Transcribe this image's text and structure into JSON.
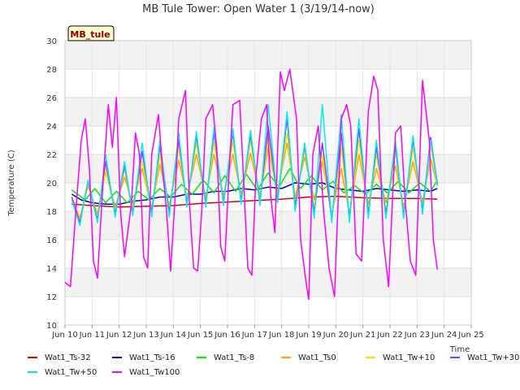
{
  "chart_data": {
    "type": "line",
    "title": "MB Tule Tower: Open Water 1 (3/19/14-now)",
    "xlabel": "Time",
    "ylabel": "Temperature (C)",
    "xlim": [
      10,
      25
    ],
    "ylim": [
      10,
      30
    ],
    "x_ticks": [
      10,
      11,
      12,
      13,
      14,
      15,
      16,
      17,
      18,
      19,
      20,
      21,
      22,
      23,
      24,
      25
    ],
    "x_tick_labels": [
      "Jun 10",
      "Jun 11",
      "Jun 12",
      "Jun 13",
      "Jun 14",
      "Jun 15",
      "Jun 16",
      "Jun 17",
      "Jun 18",
      "Jun 19",
      "Jun 20",
      "Jun 21",
      "Jun 22",
      "Jun 23",
      "Jun 24",
      "Jun 25"
    ],
    "y_ticks": [
      10,
      12,
      14,
      16,
      18,
      20,
      22,
      24,
      26,
      28,
      30
    ],
    "y_tick_labels": [
      "10",
      "12",
      "14",
      "16",
      "18",
      "20",
      "22",
      "24",
      "26",
      "28",
      "30"
    ],
    "station_label": "MB_tule",
    "legend_position": "bottom",
    "grid": true,
    "series": [
      {
        "name": "Wat1_Ts-32",
        "color": "#dd0000",
        "x": [
          10.25,
          11.0,
          12.0,
          13.0,
          14.0,
          15.0,
          16.0,
          17.0,
          18.0,
          19.0,
          20.0,
          21.0,
          22.0,
          23.0,
          23.75
        ],
        "y": [
          18.5,
          18.4,
          18.3,
          18.35,
          18.4,
          18.55,
          18.65,
          18.75,
          18.85,
          19.0,
          19.05,
          18.95,
          18.9,
          18.9,
          18.85
        ]
      },
      {
        "name": "Wat1_Ts-16",
        "color": "#0000cc",
        "x": [
          10.25,
          10.6,
          11.0,
          11.5,
          12.0,
          12.5,
          13.0,
          13.5,
          14.0,
          14.5,
          15.0,
          15.5,
          16.0,
          16.5,
          17.0,
          17.5,
          18.0,
          18.5,
          19.0,
          19.5,
          20.0,
          20.5,
          21.0,
          21.5,
          22.0,
          22.5,
          23.0,
          23.5,
          23.75
        ],
        "y": [
          19.2,
          18.8,
          18.6,
          18.5,
          18.5,
          18.7,
          18.8,
          19.0,
          19.0,
          19.2,
          19.2,
          19.4,
          19.4,
          19.6,
          19.5,
          19.7,
          19.6,
          20.0,
          19.9,
          20.0,
          19.6,
          19.5,
          19.4,
          19.6,
          19.5,
          19.4,
          19.5,
          19.4,
          19.6
        ]
      },
      {
        "name": "Wat1_Ts-8",
        "color": "#00ee00",
        "x": [
          10.25,
          10.75,
          11.1,
          11.5,
          11.9,
          12.3,
          12.7,
          13.1,
          13.5,
          13.9,
          14.3,
          14.7,
          15.1,
          15.5,
          15.9,
          16.3,
          16.7,
          17.1,
          17.5,
          17.9,
          18.3,
          18.7,
          19.1,
          19.5,
          19.9,
          20.3,
          20.7,
          21.1,
          21.5,
          21.9,
          22.3,
          22.7,
          23.1,
          23.5,
          23.75
        ],
        "y": [
          19.5,
          18.8,
          19.6,
          18.6,
          19.4,
          18.6,
          19.4,
          18.8,
          19.6,
          19.0,
          19.9,
          19.2,
          20.2,
          19.3,
          20.5,
          19.4,
          20.6,
          19.5,
          20.7,
          19.7,
          21.0,
          19.6,
          20.5,
          19.5,
          20.1,
          19.3,
          19.8,
          19.2,
          19.9,
          19.3,
          20.1,
          19.3,
          20.0,
          19.4,
          20.2
        ]
      },
      {
        "name": "Wat1_Ts0",
        "color": "#ffa500",
        "x": [
          10.25,
          10.55,
          10.85,
          11.2,
          11.5,
          11.85,
          12.2,
          12.5,
          12.85,
          13.2,
          13.5,
          13.85,
          14.2,
          14.5,
          14.85,
          15.2,
          15.5,
          15.85,
          16.2,
          16.5,
          16.85,
          17.2,
          17.5,
          17.85,
          18.2,
          18.5,
          18.85,
          19.2,
          19.5,
          19.85,
          20.2,
          20.5,
          20.85,
          21.2,
          21.5,
          21.85,
          22.2,
          22.5,
          22.85,
          23.2,
          23.5,
          23.75
        ],
        "y": [
          19.0,
          17.5,
          19.8,
          17.8,
          20.8,
          18.3,
          20.4,
          18.5,
          21.0,
          18.2,
          21.3,
          18.4,
          21.6,
          19.0,
          22.0,
          19.0,
          22.0,
          19.1,
          22.0,
          19.2,
          22.1,
          19.1,
          22.5,
          19.3,
          22.8,
          19.0,
          21.8,
          18.8,
          21.5,
          17.8,
          21.0,
          17.8,
          22.0,
          18.5,
          21.0,
          18.6,
          21.2,
          18.3,
          21.5,
          18.6,
          21.7,
          19.8
        ]
      },
      {
        "name": "Wat1_Tw+10",
        "color": "#eeee00",
        "x": [
          10.25,
          10.55,
          10.85,
          11.2,
          11.5,
          11.85,
          12.2,
          12.5,
          12.85,
          13.2,
          13.5,
          13.85,
          14.2,
          14.5,
          14.85,
          15.2,
          15.5,
          15.85,
          16.2,
          16.5,
          16.85,
          17.2,
          17.5,
          17.85,
          18.2,
          18.5,
          18.85,
          19.2,
          19.5,
          19.85,
          20.2,
          20.5,
          20.85,
          21.2,
          21.5,
          21.85,
          22.2,
          22.5,
          22.85,
          23.2,
          23.5,
          23.75
        ],
        "y": [
          19.0,
          17.3,
          20.0,
          17.6,
          21.0,
          18.0,
          21.0,
          18.1,
          21.5,
          18.0,
          22.0,
          18.1,
          22.5,
          18.8,
          22.8,
          18.7,
          22.8,
          18.8,
          22.9,
          18.9,
          23.0,
          18.8,
          23.3,
          19.0,
          23.5,
          18.5,
          22.3,
          18.2,
          22.0,
          17.5,
          22.5,
          17.4,
          23.0,
          18.0,
          22.0,
          18.0,
          22.2,
          17.9,
          22.5,
          18.2,
          22.6,
          19.9
        ]
      },
      {
        "name": "Wat1_Tw+30",
        "color": "#9933ff",
        "x": [
          10.25,
          10.55,
          10.85,
          11.2,
          11.5,
          11.85,
          12.2,
          12.5,
          12.85,
          13.2,
          13.5,
          13.85,
          14.2,
          14.5,
          14.85,
          15.2,
          15.5,
          15.85,
          16.2,
          16.5,
          16.85,
          17.2,
          17.5,
          17.85,
          18.2,
          18.5,
          18.85,
          19.2,
          19.5,
          19.85,
          20.2,
          20.5,
          20.85,
          21.2,
          21.5,
          21.85,
          22.2,
          22.5,
          22.85,
          23.2,
          23.5,
          23.75
        ],
        "y": [
          19.0,
          17.2,
          20.1,
          17.4,
          21.5,
          17.8,
          21.2,
          17.9,
          22.2,
          17.9,
          22.6,
          17.9,
          23.0,
          18.5,
          23.3,
          18.5,
          23.5,
          18.6,
          23.5,
          18.7,
          23.4,
          18.6,
          24.0,
          18.8,
          24.5,
          18.3,
          22.6,
          17.9,
          22.8,
          17.4,
          23.5,
          17.5,
          23.8,
          17.8,
          22.5,
          17.8,
          22.6,
          17.7,
          23.0,
          18.0,
          23.2,
          19.9
        ]
      },
      {
        "name": "Wat1_Tw+50",
        "color": "#00eeee",
        "x": [
          10.25,
          10.55,
          10.85,
          11.2,
          11.5,
          11.85,
          12.2,
          12.5,
          12.85,
          13.2,
          13.5,
          13.85,
          14.2,
          14.5,
          14.85,
          15.2,
          15.5,
          15.85,
          16.2,
          16.5,
          16.85,
          17.2,
          17.5,
          17.85,
          18.2,
          18.5,
          18.85,
          19.2,
          19.5,
          19.85,
          20.2,
          20.5,
          20.85,
          21.2,
          21.5,
          21.85,
          22.2,
          22.5,
          22.85,
          23.2,
          23.5,
          23.75
        ],
        "y": [
          18.8,
          17.0,
          20.2,
          17.2,
          22.0,
          17.6,
          21.5,
          17.7,
          22.8,
          17.6,
          23.0,
          17.6,
          23.5,
          18.3,
          23.6,
          18.3,
          23.9,
          18.4,
          23.8,
          18.5,
          23.7,
          18.4,
          25.5,
          18.6,
          25.0,
          18.0,
          22.8,
          17.5,
          25.5,
          17.2,
          24.8,
          17.2,
          24.5,
          17.5,
          23.0,
          17.5,
          23.0,
          17.5,
          23.3,
          17.8,
          23.0,
          19.8
        ]
      },
      {
        "name": "Wat1_Tw100",
        "color": "#ff00ff",
        "x": [
          10.0,
          10.2,
          10.4,
          10.6,
          10.75,
          10.9,
          11.05,
          11.2,
          11.4,
          11.6,
          11.75,
          11.9,
          12.05,
          12.2,
          12.45,
          12.6,
          12.75,
          12.9,
          13.05,
          13.2,
          13.45,
          13.6,
          13.75,
          13.9,
          14.05,
          14.2,
          14.45,
          14.6,
          14.75,
          14.9,
          15.05,
          15.2,
          15.45,
          15.6,
          15.75,
          15.9,
          16.05,
          16.2,
          16.45,
          16.6,
          16.75,
          16.9,
          17.05,
          17.25,
          17.45,
          17.6,
          17.75,
          17.95,
          18.1,
          18.3,
          18.55,
          18.7,
          18.9,
          19.0,
          19.15,
          19.35,
          19.55,
          19.75,
          19.95,
          20.2,
          20.4,
          20.55,
          20.75,
          20.95,
          21.2,
          21.4,
          21.55,
          21.75,
          21.95,
          22.2,
          22.4,
          22.55,
          22.75,
          22.95,
          23.2,
          23.45,
          23.6,
          23.75
        ],
        "y": [
          13.0,
          12.7,
          18.0,
          23.0,
          24.5,
          21.0,
          14.5,
          13.3,
          20.0,
          25.5,
          22.5,
          26.0,
          18.0,
          14.8,
          18.5,
          23.5,
          22.0,
          14.8,
          14.0,
          22.0,
          24.8,
          21.0,
          18.0,
          13.8,
          18.5,
          24.5,
          26.5,
          18.5,
          14.0,
          13.8,
          18.0,
          24.5,
          25.5,
          22.5,
          15.5,
          14.5,
          20.5,
          25.5,
          25.8,
          20.0,
          14.0,
          13.5,
          20.5,
          24.5,
          25.5,
          19.0,
          16.5,
          27.8,
          26.5,
          28.0,
          24.5,
          16.0,
          13.0,
          11.8,
          22.0,
          24.0,
          18.0,
          14.0,
          12.0,
          24.5,
          25.5,
          24.0,
          15.0,
          14.5,
          25.0,
          27.5,
          26.5,
          16.0,
          12.7,
          23.5,
          24.0,
          19.0,
          14.5,
          13.5,
          27.2,
          23.0,
          16.0,
          13.9
        ]
      }
    ]
  }
}
